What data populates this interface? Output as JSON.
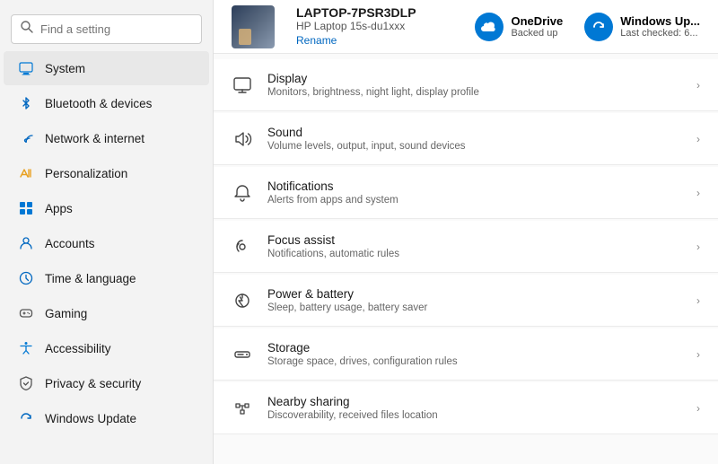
{
  "search": {
    "placeholder": "Find a setting"
  },
  "device": {
    "name": "LAPTOP-7PSR3DLP",
    "model": "HP Laptop 15s-du1xxx",
    "rename_label": "Rename"
  },
  "onedrive": {
    "label": "OneDrive",
    "status": "Backed up"
  },
  "windows_update": {
    "label": "Windows Up...",
    "status": "Last checked: 6..."
  },
  "sidebar": {
    "items": [
      {
        "id": "system",
        "label": "System",
        "icon": "system",
        "active": true
      },
      {
        "id": "bluetooth",
        "label": "Bluetooth & devices",
        "icon": "bluetooth",
        "active": false
      },
      {
        "id": "network",
        "label": "Network & internet",
        "icon": "network",
        "active": false
      },
      {
        "id": "personalization",
        "label": "Personalization",
        "icon": "personalization",
        "active": false
      },
      {
        "id": "apps",
        "label": "Apps",
        "icon": "apps",
        "active": false
      },
      {
        "id": "accounts",
        "label": "Accounts",
        "icon": "accounts",
        "active": false
      },
      {
        "id": "time",
        "label": "Time & language",
        "icon": "time",
        "active": false
      },
      {
        "id": "gaming",
        "label": "Gaming",
        "icon": "gaming",
        "active": false
      },
      {
        "id": "accessibility",
        "label": "Accessibility",
        "icon": "accessibility",
        "active": false
      },
      {
        "id": "privacy",
        "label": "Privacy & security",
        "icon": "privacy",
        "active": false
      },
      {
        "id": "update",
        "label": "Windows Update",
        "icon": "update",
        "active": false
      }
    ]
  },
  "settings": {
    "items": [
      {
        "id": "display",
        "title": "Display",
        "desc": "Monitors, brightness, night light, display profile",
        "icon": "display"
      },
      {
        "id": "sound",
        "title": "Sound",
        "desc": "Volume levels, output, input, sound devices",
        "icon": "sound"
      },
      {
        "id": "notifications",
        "title": "Notifications",
        "desc": "Alerts from apps and system",
        "icon": "notifications"
      },
      {
        "id": "focus",
        "title": "Focus assist",
        "desc": "Notifications, automatic rules",
        "icon": "focus"
      },
      {
        "id": "power",
        "title": "Power & battery",
        "desc": "Sleep, battery usage, battery saver",
        "icon": "power"
      },
      {
        "id": "storage",
        "title": "Storage",
        "desc": "Storage space, drives, configuration rules",
        "icon": "storage"
      },
      {
        "id": "nearby",
        "title": "Nearby sharing",
        "desc": "Discoverability, received files location",
        "icon": "nearby"
      }
    ]
  }
}
